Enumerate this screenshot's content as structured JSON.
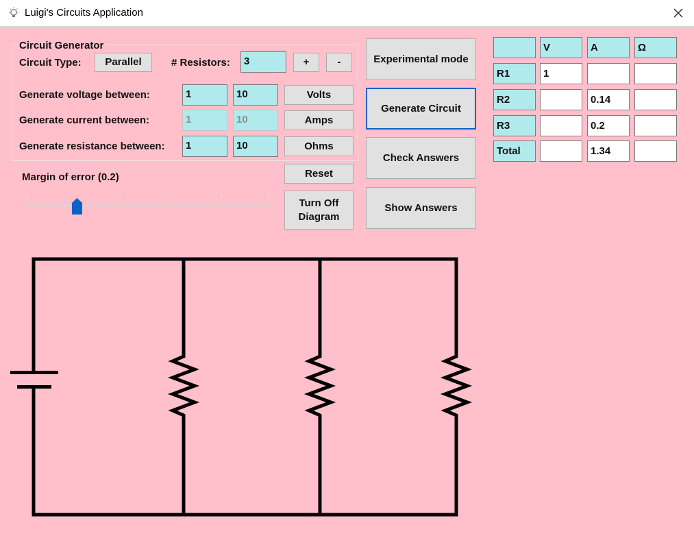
{
  "window": {
    "title": "Luigi's Circuits Application",
    "icon": "lightbulb-icon",
    "close_icon": "close-icon"
  },
  "generator": {
    "title": "Circuit Generator",
    "circuit_type_label": "Circuit Type:",
    "circuit_type_value": "Parallel",
    "resistors_label": "# Resistors:",
    "resistors_value": "3",
    "plus_label": "+",
    "minus_label": "-",
    "voltage": {
      "label": "Generate voltage between:",
      "min": "1",
      "max": "10",
      "button": "Volts"
    },
    "current": {
      "label": "Generate current between:",
      "min": "1",
      "max": "10",
      "button": "Amps"
    },
    "resistance": {
      "label": "Generate resistance between:",
      "min": "1",
      "max": "10",
      "button": "Ohms"
    }
  },
  "margin": {
    "label": "Margin of error (0.2)",
    "value_fraction": 0.2
  },
  "buttons": {
    "reset": "Reset",
    "turn_off_diagram": "Turn Off Diagram",
    "experimental_mode": "Experimental mode",
    "generate_circuit": "Generate Circuit",
    "check_answers": "Check Answers",
    "show_answers": "Show Answers"
  },
  "table": {
    "columns": [
      "",
      "V",
      "A",
      "Ω"
    ],
    "rows": [
      {
        "name": "R1",
        "V": "1",
        "A": "",
        "Ohm": ""
      },
      {
        "name": "R2",
        "V": "",
        "A": "0.14",
        "Ohm": ""
      },
      {
        "name": "R3",
        "V": "",
        "A": "0.2",
        "Ohm": ""
      },
      {
        "name": "Total",
        "V": "",
        "A": "1.34",
        "Ohm": ""
      }
    ]
  },
  "diagram": {
    "type": "parallel",
    "resistor_count": 3
  },
  "colors": {
    "background": "#ffbfcb",
    "field": "#b0eaec",
    "button": "#e1e1e1",
    "accent": "#0a64c8"
  }
}
